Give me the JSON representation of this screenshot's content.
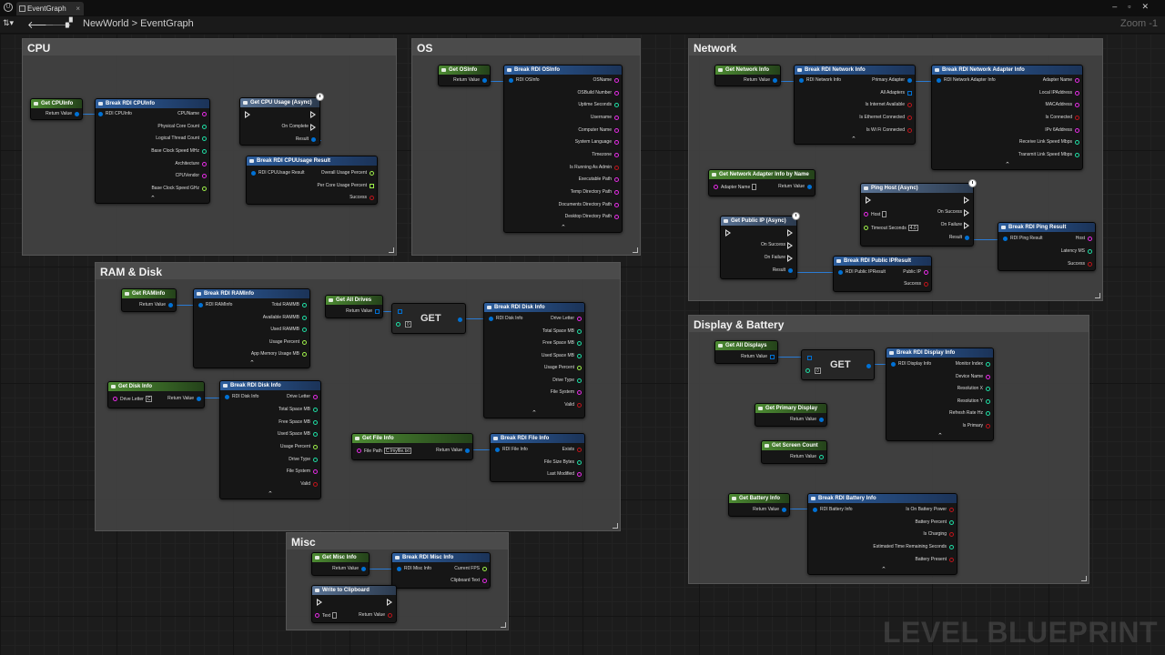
{
  "titlebar": {
    "tab": "EventGraph"
  },
  "toolbar": {
    "crumb1": "NewWorld",
    "sep": ">",
    "crumb2": "EventGraph",
    "zoom": "Zoom -1"
  },
  "colors": {
    "bool": "#8c0c00",
    "int": "#1fe0a6",
    "float": "#9ef04a",
    "string": "#e62ce6",
    "struct": "#0071d5",
    "exec": "#ffffff"
  },
  "comments": {
    "cpu": "CPU",
    "os": "OS",
    "network": "Network",
    "ramdisk": "RAM & Disk",
    "display": "Display & Battery",
    "misc": "Misc"
  },
  "n": {
    "getcpu": {
      "t": "Get CPUInfo",
      "p": [
        "Return Value"
      ]
    },
    "brkcpu": {
      "t": "Break RDI CPUInfo",
      "p": [
        "RDI CPUInfo",
        "CPUName",
        "Physical Core Count",
        "Logical Thread Count",
        "Base Clock Speed MHz",
        "Architecture",
        "CPUVendor",
        "Base Clock Speed GHz"
      ]
    },
    "getcpuusage": {
      "t": "Get CPU Usage (Async)",
      "p": [
        "On Complete",
        "Result"
      ]
    },
    "brkcpuusage": {
      "t": "Break RDI CPUUsage Result",
      "p": [
        "RDI CPUUsage Result",
        "Overall Usage Percent",
        "Per Core Usage Percent",
        "Success"
      ]
    },
    "getos": {
      "t": "Get OSInfo",
      "p": [
        "Return Value"
      ]
    },
    "brkos": {
      "t": "Break RDI OSInfo",
      "p": [
        "RDI OSInfo",
        "OSName",
        "OSBuild Number",
        "Uptime Seconds",
        "Username",
        "Computer Name",
        "System Language",
        "Timezone",
        "Is Running As Admin",
        "Executable Path",
        "Temp Directory Path",
        "Documents Directory Path",
        "Desktop Directory Path"
      ]
    },
    "getnet": {
      "t": "Get Network Info",
      "p": [
        "Return Value"
      ]
    },
    "brknet": {
      "t": "Break RDI Network Info",
      "p": [
        "RDI Network Info",
        "Primary Adapter",
        "All Adapters",
        "Is Internet Available",
        "Is Ethernet Connected",
        "Is Wi Fi Connected"
      ]
    },
    "brkadapter": {
      "t": "Break RDI Network Adapter Info",
      "p": [
        "RDI Network Adapter Info",
        "Adapter Name",
        "Local IPAddress",
        "MACAddress",
        "Is Connected",
        "IPv 6Address",
        "Receive Link Speed Mbps",
        "Transmit Link Speed Mbps"
      ]
    },
    "getadapterbyname": {
      "t": "Get Network Adapter Info by Name",
      "p": [
        "Adapter Name",
        "Return Value"
      ]
    },
    "ping": {
      "t": "Ping Host (Async)",
      "p": [
        "Host",
        "Timeout Seconds",
        "4.0",
        "On Success",
        "On Failure",
        "Result"
      ]
    },
    "getpubip": {
      "t": "Get Public IP (Async)",
      "p": [
        "On Success",
        "On Failure",
        "Result"
      ]
    },
    "brkping": {
      "t": "Break RDI Ping Result",
      "p": [
        "RDI Ping Result",
        "Host",
        "Latency MS",
        "Success"
      ]
    },
    "brkpubip": {
      "t": "Break RDI Public IPResult",
      "p": [
        "RDI Public IPResult",
        "Public IP",
        "Success"
      ]
    },
    "getram": {
      "t": "Get RAMInfo",
      "p": [
        "Return Value"
      ]
    },
    "brkram": {
      "t": "Break RDI RAMInfo",
      "p": [
        "RDI RAMInfo",
        "Total RAMMB",
        "Available RAMMB",
        "Used RAMMB",
        "Usage Percent",
        "App Memory Usage MB"
      ]
    },
    "getdrives": {
      "t": "Get All Drives",
      "p": [
        "Return Value"
      ]
    },
    "get1": {
      "t": "GET",
      "idx": "0"
    },
    "brkdisk1": {
      "t": "Break RDI Disk Info",
      "p": [
        "RDI Disk Info",
        "Drive Letter",
        "Total Space MB",
        "Free Space MB",
        "Used Space MB",
        "Usage Percent",
        "Drive Type",
        "File System",
        "Valid"
      ]
    },
    "getdisk": {
      "t": "Get Disk Info",
      "p": [
        "Drive Letter",
        "C",
        "Return Value"
      ]
    },
    "brkdisk2": {
      "t": "Break RDI Disk Info",
      "p": [
        "RDI Disk Info",
        "Drive Letter",
        "Total Space MB",
        "Free Space MB",
        "Used Space MB",
        "Usage Percent",
        "Drive Type",
        "File System",
        "Valid"
      ]
    },
    "getfile": {
      "t": "Get File Info",
      "p": [
        "File Path",
        "C:/myfile.txt",
        "Return Value"
      ]
    },
    "brkfile": {
      "t": "Break RDI File Info",
      "p": [
        "RDI File Info",
        "Exists",
        "File Size Bytes",
        "Last Modified"
      ]
    },
    "getdisplays": {
      "t": "Get All Displays",
      "p": [
        "Return Value"
      ]
    },
    "get2": {
      "t": "GET",
      "idx": "0"
    },
    "brkdisplay": {
      "t": "Break RDI Display Info",
      "p": [
        "RDI Display Info",
        "Monitor Index",
        "Device Name",
        "Resolution X",
        "Resolution Y",
        "Refresh Rate Hz",
        "Is Primary"
      ]
    },
    "getprimary": {
      "t": "Get Primary Display",
      "p": [
        "Return Value"
      ]
    },
    "getscreencount": {
      "t": "Get Screen Count",
      "p": [
        "Return Value"
      ]
    },
    "getbattery": {
      "t": "Get Battery Info",
      "p": [
        "Return Value"
      ]
    },
    "brkbattery": {
      "t": "Break RDI Battery Info",
      "p": [
        "RDI Battery Info",
        "Is On Battery Power",
        "Battery Percent",
        "Is Charging",
        "Estimated Time Remaining Seconds",
        "Battery Present"
      ]
    },
    "getmisc": {
      "t": "Get Misc Info",
      "p": [
        "Return Value"
      ]
    },
    "brkmisc": {
      "t": "Break RDI Misc Info",
      "p": [
        "RDI Misc Info",
        "Current FPS",
        "Clipboard Text"
      ]
    },
    "clip": {
      "t": "Write to Clipboard",
      "p": [
        "Text",
        "Return Value"
      ]
    }
  },
  "watermark": "LEVEL BLUEPRINT"
}
